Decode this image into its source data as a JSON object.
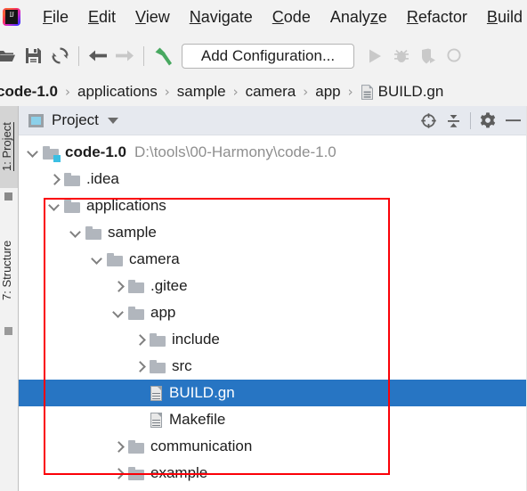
{
  "window": {
    "logo_icon": "intellij-idea-logo"
  },
  "menubar": {
    "items": [
      {
        "label": "File",
        "mnemonic_index": 0
      },
      {
        "label": "Edit",
        "mnemonic_index": 0
      },
      {
        "label": "View",
        "mnemonic_index": 0
      },
      {
        "label": "Navigate",
        "mnemonic_index": 0
      },
      {
        "label": "Code",
        "mnemonic_index": 0
      },
      {
        "label": "Analyze",
        "mnemonic_index": 5
      },
      {
        "label": "Refactor",
        "mnemonic_index": 0
      },
      {
        "label": "Build",
        "mnemonic_index": 0
      }
    ]
  },
  "toolbar": {
    "open_label": "open-folder-icon",
    "save_label": "save-icon",
    "sync_label": "sync-icon",
    "back_label": "back-arrow-icon",
    "forward_label": "forward-arrow-icon",
    "build_label": "build-hammer-icon",
    "add_configuration": "Add Configuration...",
    "run_label": "run-icon",
    "debug_label": "debug-icon",
    "coverage_label": "run-with-coverage-icon",
    "search_label": "search-everywhere-icon"
  },
  "breadcrumb": {
    "separator": "›",
    "items": [
      {
        "label": "code-1.0",
        "type": "project",
        "bold": true
      },
      {
        "label": "applications",
        "type": "folder"
      },
      {
        "label": "sample",
        "type": "folder"
      },
      {
        "label": "camera",
        "type": "folder"
      },
      {
        "label": "app",
        "type": "folder"
      },
      {
        "label": "BUILD.gn",
        "type": "file"
      }
    ]
  },
  "toolstrip": {
    "tabs": [
      {
        "label": "1: Project",
        "active": true
      },
      {
        "label": "7: Structure",
        "active": false
      }
    ]
  },
  "panel": {
    "title": "Project",
    "view_selector_icon": "project-view-icon",
    "dropdown_icon": "chevron-down-icon",
    "actions": [
      {
        "name": "select-opened-file-icon",
        "tooltip": "Select Opened File"
      },
      {
        "name": "collapse-all-icon",
        "tooltip": "Collapse All"
      },
      {
        "name": "settings-gear-icon",
        "tooltip": "Settings"
      },
      {
        "name": "hide-icon",
        "tooltip": "Hide"
      }
    ]
  },
  "tree": {
    "nodes": [
      {
        "label": "code-1.0",
        "path": "D:\\tools\\00-Harmony\\code-1.0",
        "indent": 0,
        "arrow": "down",
        "icon": "project-folder",
        "bold": true,
        "selected": false
      },
      {
        "label": ".idea",
        "path": "",
        "indent": 1,
        "arrow": "right",
        "icon": "folder",
        "bold": false,
        "selected": false
      },
      {
        "label": "applications",
        "path": "",
        "indent": 1,
        "arrow": "down",
        "icon": "folder",
        "bold": false,
        "selected": false
      },
      {
        "label": "sample",
        "path": "",
        "indent": 2,
        "arrow": "down",
        "icon": "folder",
        "bold": false,
        "selected": false
      },
      {
        "label": "camera",
        "path": "",
        "indent": 3,
        "arrow": "down",
        "icon": "folder",
        "bold": false,
        "selected": false
      },
      {
        "label": ".gitee",
        "path": "",
        "indent": 4,
        "arrow": "right",
        "icon": "folder",
        "bold": false,
        "selected": false
      },
      {
        "label": "app",
        "path": "",
        "indent": 4,
        "arrow": "down",
        "icon": "folder",
        "bold": false,
        "selected": false
      },
      {
        "label": "include",
        "path": "",
        "indent": 5,
        "arrow": "right",
        "icon": "folder",
        "bold": false,
        "selected": false
      },
      {
        "label": "src",
        "path": "",
        "indent": 5,
        "arrow": "right",
        "icon": "folder",
        "bold": false,
        "selected": false
      },
      {
        "label": "BUILD.gn",
        "path": "",
        "indent": 5,
        "arrow": "none",
        "icon": "file",
        "bold": false,
        "selected": true
      },
      {
        "label": "Makefile",
        "path": "",
        "indent": 5,
        "arrow": "none",
        "icon": "file",
        "bold": false,
        "selected": false
      },
      {
        "label": "communication",
        "path": "",
        "indent": 4,
        "arrow": "right",
        "icon": "folder",
        "bold": false,
        "selected": false
      },
      {
        "label": "example",
        "path": "",
        "indent": 4,
        "arrow": "right",
        "icon": "folder",
        "bold": false,
        "selected": false
      }
    ]
  },
  "annotation": {
    "highlight_box_color": "#fb0007"
  },
  "colors": {
    "selection_blue": "#2775c3",
    "panel_header_bg": "#e6e9ef",
    "chrome_bg": "#f2f2f2",
    "folder_gray": "#b1b6bd",
    "accent_cyan": "#3bbfe3"
  }
}
